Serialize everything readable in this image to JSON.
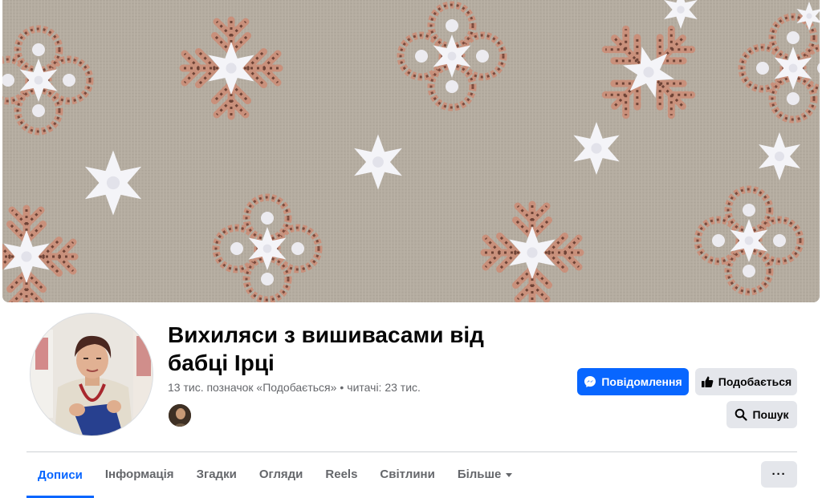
{
  "page": {
    "name": "Вихиляси з вишивасами від бабці Ірці",
    "likes": "13 тис. позначок «Подобається»",
    "separator": "•",
    "followers": "читачі: 23 тис."
  },
  "buttons": {
    "message": "Повідомлення",
    "like": "Подобається",
    "search": "Пошук",
    "more": "···"
  },
  "tabs": [
    {
      "label": "Дописи",
      "active": true
    },
    {
      "label": "Інформація"
    },
    {
      "label": "Згадки"
    },
    {
      "label": "Огляди"
    },
    {
      "label": "Reels"
    },
    {
      "label": "Світлини"
    },
    {
      "label": "Більше"
    }
  ],
  "colors": {
    "brand_blue": "#0866ff",
    "secondary_bg": "#e4e6eb",
    "muted_text": "#65676b",
    "embroidery_thread": "#c9907b",
    "linen": "#b8b0a3"
  }
}
